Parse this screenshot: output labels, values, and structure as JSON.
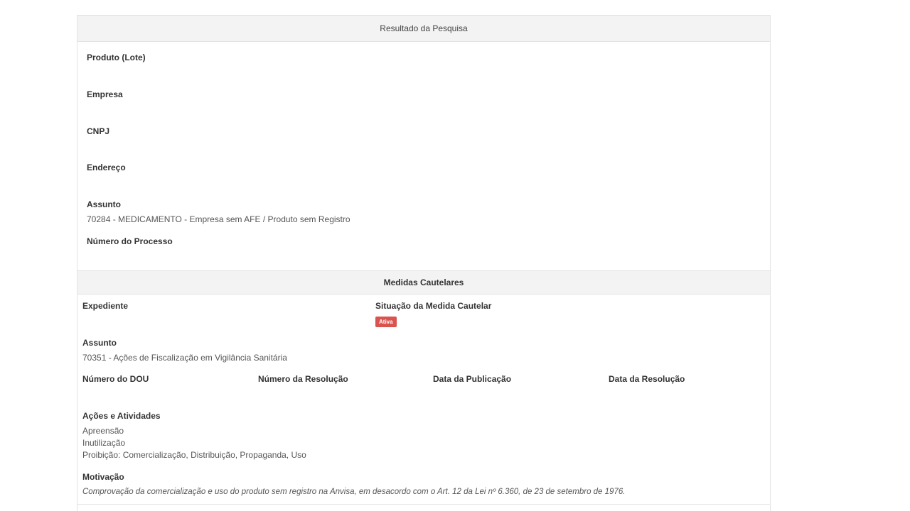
{
  "result": {
    "title": "Resultado da Pesquisa",
    "fields": {
      "produto_label": "Produto (Lote)",
      "empresa_label": "Empresa",
      "cnpj_label": "CNPJ",
      "endereco_label": "Endereço",
      "assunto_label": "Assunto",
      "assunto_value": "70284 - MEDICAMENTO - Empresa sem AFE / Produto sem Registro",
      "processo_label": "Número do Processo"
    }
  },
  "medidas": {
    "title": "Medidas Cautelares",
    "expediente_label": "Expediente",
    "situacao_label": "Situação da Medida Cautelar",
    "situacao_badge": "Ativa",
    "assunto_label": "Assunto",
    "assunto_value": "70351 - Ações de Fiscalização em Vigilância Sanitária",
    "dou_label": "Número do DOU",
    "resolucao_label": "Número da Resolução",
    "publicacao_label": "Data da Publicação",
    "data_resolucao_label": "Data da Resolução",
    "acoes_label": "Ações e Atividades",
    "acoes": [
      "Apreensão",
      "Inutilização",
      "Proibição: Comercialização, Distribuição, Propaganda, Uso"
    ],
    "motivacao_label": "Motivação",
    "motivacao_value": "Comprovação da comercialização e uso do produto sem registro na Anvisa, em desacordo com o Art. 12 da Lei nº 6.360, de 23 de setembro de 1976."
  },
  "colors": {
    "header_bg": "#f3f3f3",
    "border": "#e3e3e3",
    "badge_active": "#d9534f"
  }
}
